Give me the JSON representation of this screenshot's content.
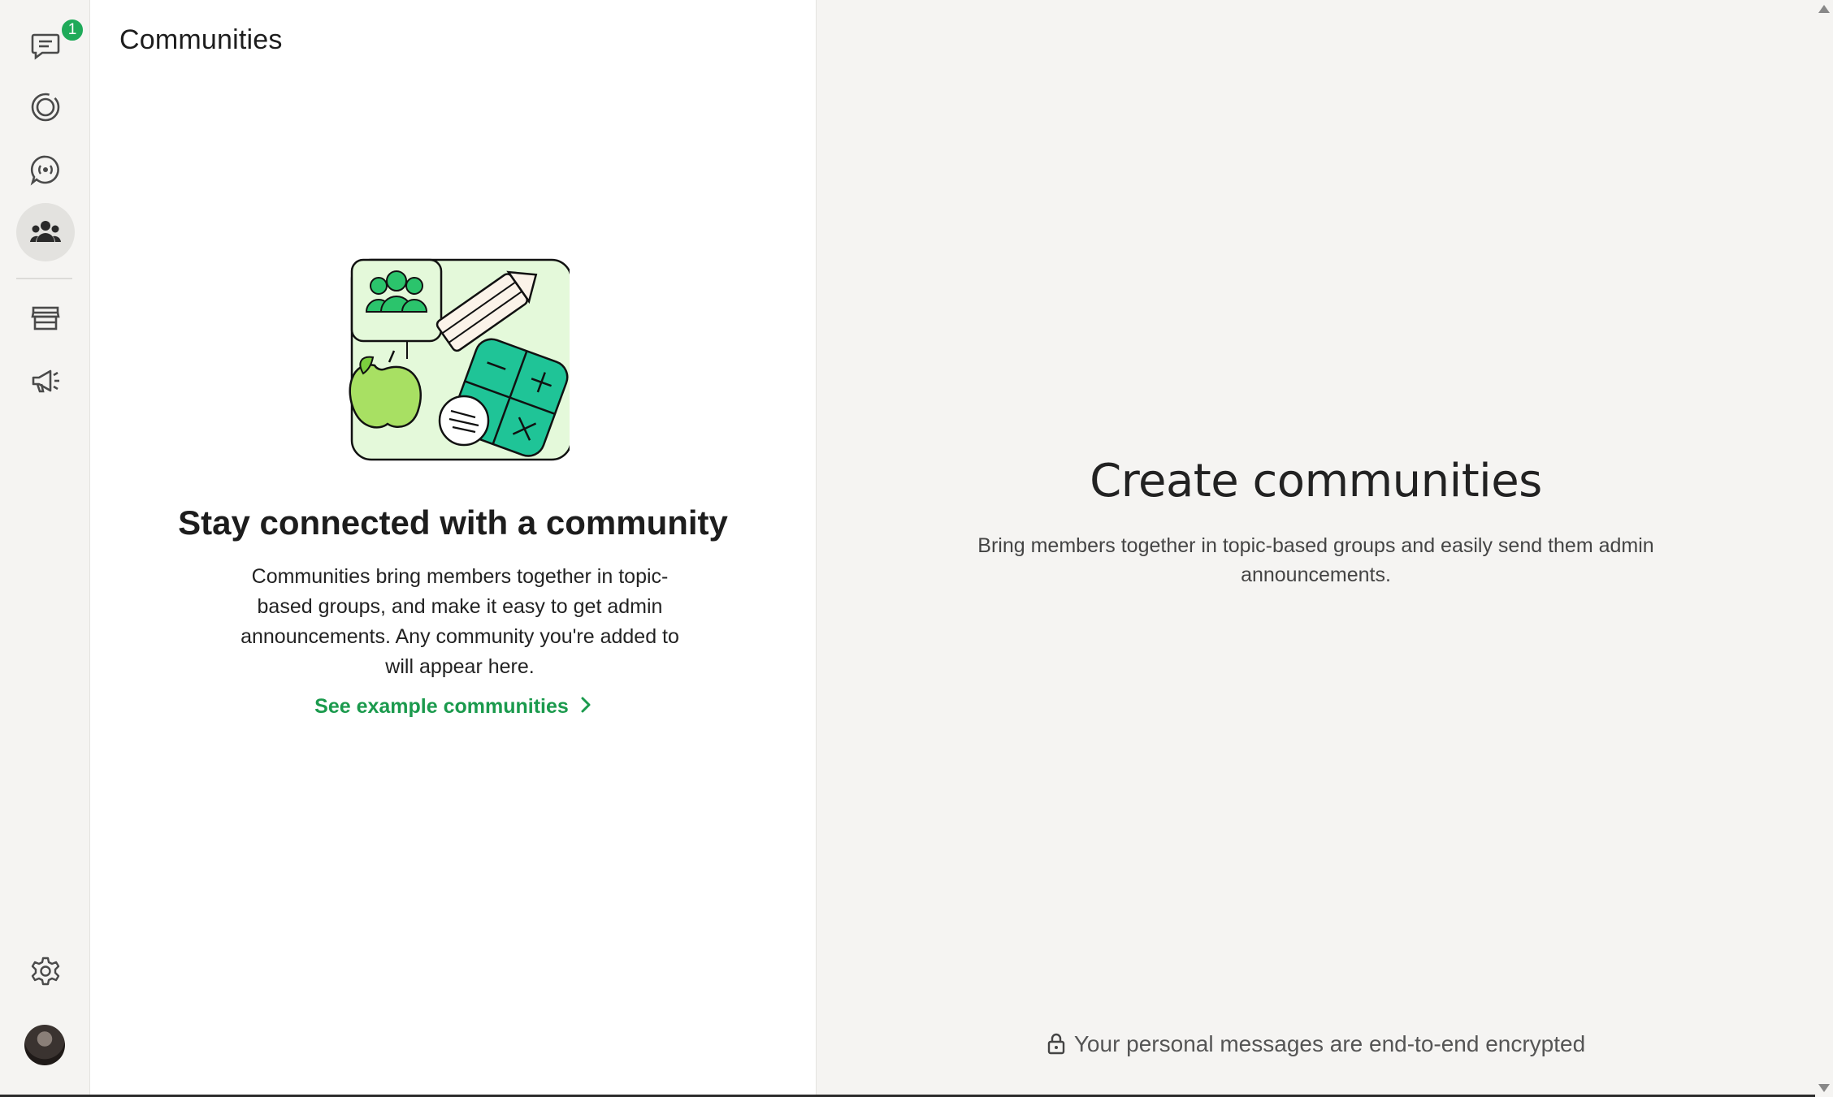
{
  "nav": {
    "chats_badge": "1",
    "items": [
      {
        "name": "chats-icon"
      },
      {
        "name": "status-icon"
      },
      {
        "name": "channels-icon"
      },
      {
        "name": "communities-icon"
      },
      {
        "name": "store-icon"
      },
      {
        "name": "megaphone-icon"
      },
      {
        "name": "settings-icon"
      }
    ]
  },
  "panel": {
    "title": "Communities",
    "empty_heading": "Stay connected with a community",
    "empty_body": "Communities bring members together in topic-based groups, and make it easy to get admin announcements. Any community you're added to will appear here.",
    "example_link": "See example communities"
  },
  "detail": {
    "title": "Create communities",
    "body": "Bring members together in topic-based groups and easily send them admin announcements.",
    "encryption_note": "Your personal messages are end-to-end encrypted"
  },
  "colors": {
    "accent_green": "#1b9a4d",
    "badge_green": "#1faa59",
    "rail_background": "#f5f4f2",
    "panel_background": "#ffffff"
  }
}
